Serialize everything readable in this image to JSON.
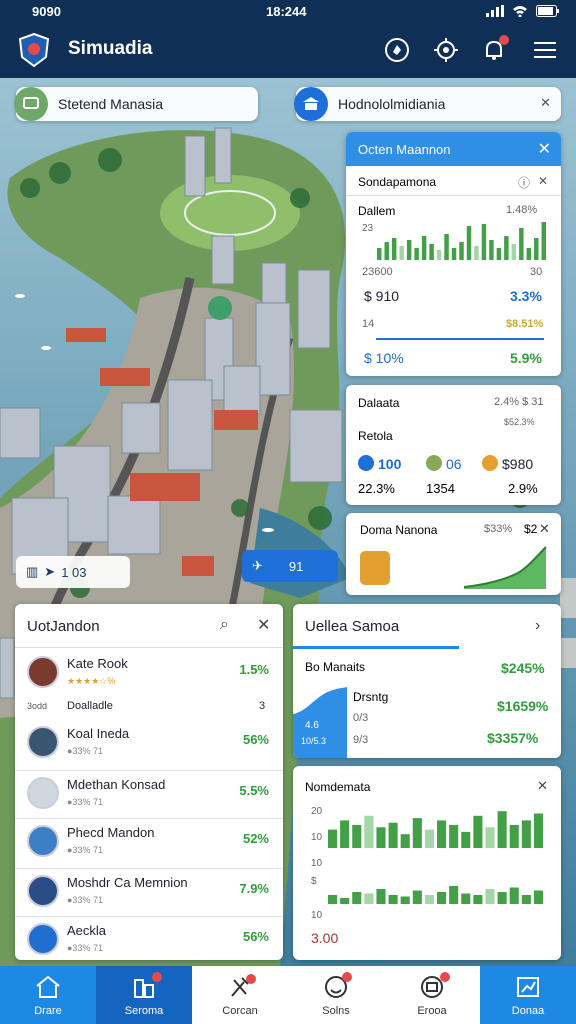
{
  "status_bar": {
    "left_time": "9090",
    "center_time": "18:244"
  },
  "app": {
    "title": "Simuadia"
  },
  "search_left": {
    "text": "Stetend Manasia"
  },
  "search_right": {
    "text": "Hodnololmidiania"
  },
  "panel_top": {
    "header": "Octen Maannon",
    "subheader": "Sondapamona",
    "rows": [
      {
        "label": "Dallem",
        "value": "1.48%"
      },
      {
        "label": "23",
        "value": ""
      },
      {
        "label": "23600",
        "value": "30"
      },
      {
        "label": "$ 910",
        "value": "3.3%"
      },
      {
        "label": "14",
        "value": "$8.51%"
      },
      {
        "label": "$ 10%",
        "value": "5.9%"
      }
    ],
    "bars_a": [
      0.3,
      0.45,
      0.55,
      0.35,
      0.5,
      0.3,
      0.6,
      0.4,
      0.25,
      0.65,
      0.3,
      0.45,
      0.85,
      0.35,
      0.9,
      0.5,
      0.3,
      0.6,
      0.4,
      0.8,
      0.3,
      0.55,
      0.95
    ]
  },
  "panel_mid": {
    "title": "Dalaata",
    "title_val": "2.4% $ 31",
    "label2": "Retola",
    "label2_val": "$52.3%",
    "items": [
      {
        "color": "#1e6fd8",
        "value": "100"
      },
      {
        "color": "#8aa85a",
        "value": "06"
      },
      {
        "color": "#e3a02e",
        "value": "$980"
      }
    ],
    "bottom": [
      "22.3%",
      "1354",
      "2.9%"
    ]
  },
  "panel_small": {
    "title": "Doma Nanona",
    "value": "$33%",
    "x": "$2"
  },
  "map_chips": {
    "left": "1 03",
    "right": "91"
  },
  "list_panel": {
    "title": "UotJandon",
    "items": [
      {
        "name": "Kate Rook",
        "sub": "★★★★☆%",
        "pct": "1.5%",
        "color": "#7a3b2e"
      },
      {
        "name": "Doalladle",
        "sub": "3",
        "pct": "",
        "color": "#ffffff",
        "label": "3odd"
      },
      {
        "name": "Koal Ineda",
        "sub": "●33% 71",
        "pct": "56%",
        "color": "#3a5570"
      },
      {
        "name": "Mdethan Konsad",
        "sub": "●33% 71",
        "pct": "5.5%",
        "color": "#cfd8dc"
      },
      {
        "name": "Phecd Mandon",
        "sub": "●33% 71",
        "pct": "52%",
        "color": "#3c7fc5"
      },
      {
        "name": "Moshdr Ca Memnion",
        "sub": "●33% 71",
        "pct": "7.9%",
        "color": "#2a4d86"
      },
      {
        "name": "Aeckla",
        "sub": "●33% 71",
        "pct": "56%",
        "color": "#1f6fd0"
      }
    ]
  },
  "right_panel": {
    "title": "Uellea Samoa",
    "rows": [
      {
        "label": "Bo Manaits",
        "value": "$245%"
      },
      {
        "label": "Drsntg",
        "value": "$1659%"
      },
      {
        "label": "0/3",
        "value": ""
      },
      {
        "label": "9/3",
        "value": "$3357%"
      }
    ],
    "mini_labels": [
      "4.6",
      "10/5.3"
    ]
  },
  "nonstats": {
    "title": "Nomdemata",
    "axis": [
      "20",
      "10",
      "10",
      "$",
      "10"
    ],
    "bottom": "3.00",
    "bars_top": [
      0.4,
      0.6,
      0.5,
      0.7,
      0.45,
      0.55,
      0.3,
      0.65,
      0.4,
      0.6,
      0.5,
      0.35,
      0.7,
      0.45,
      0.8,
      0.5,
      0.6,
      0.75
    ],
    "bars_bot": [
      0.3,
      0.2,
      0.4,
      0.35,
      0.5,
      0.3,
      0.25,
      0.45,
      0.3,
      0.4,
      0.6,
      0.35,
      0.3,
      0.5,
      0.4,
      0.55,
      0.3,
      0.45
    ]
  },
  "bottom_nav": [
    {
      "label": "Drare",
      "icon": "home-icon"
    },
    {
      "label": "Seroma",
      "icon": "city-icon"
    },
    {
      "label": "Corcan",
      "icon": "tools-icon"
    },
    {
      "label": "Solns",
      "icon": "people-icon"
    },
    {
      "label": "Erooa",
      "icon": "globe-icon"
    },
    {
      "label": "Donaa",
      "icon": "stats-icon"
    }
  ],
  "colors": {
    "primary": "#1e88e5",
    "dark": "#0f2f57",
    "positive": "#2f9e3a",
    "water": "#4f8aa8"
  }
}
